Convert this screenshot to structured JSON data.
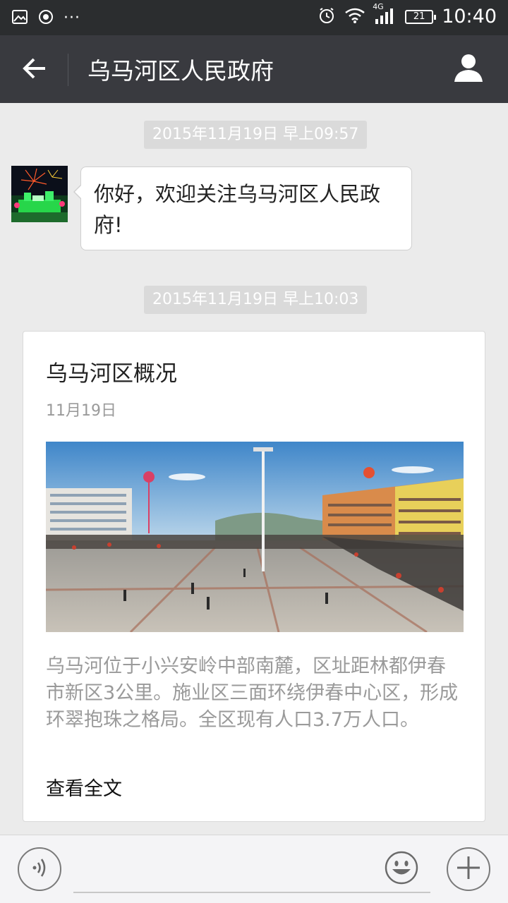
{
  "status_bar": {
    "time": "10:40",
    "battery_level": "21",
    "network": "4G",
    "left_icons": [
      "image-icon",
      "record-icon",
      "more-dots-icon"
    ],
    "right_icons": [
      "alarm-icon",
      "wifi-icon",
      "signal-icon",
      "battery-icon"
    ]
  },
  "header": {
    "title": "乌马河区人民政府",
    "back_icon": "arrow-left-icon",
    "profile_icon": "person-icon"
  },
  "messages": [
    {
      "timestamp": "2015年11月19日 早上09:57",
      "text": "你好，欢迎关注乌马河区人民政府!"
    },
    {
      "timestamp": "2015年11月19日 早上10:03",
      "article": {
        "title": "乌马河区概况",
        "date": "11月19日",
        "description": "乌马河位于小兴安岭中部南麓，区址距林都伊春市新区3公里。施业区三面环绕伊春中心区，形成环翠抱珠之格局。全区现有人口3.7万人口。",
        "read_more": "查看全文"
      }
    }
  ],
  "input_bar": {
    "voice_icon": "voice-icon",
    "emoji_icon": "emoji-icon",
    "plus_icon": "plus-icon",
    "input_value": ""
  },
  "colors": {
    "status_bar_bg": "#2b2d2f",
    "title_bar_bg": "#393a3f",
    "chat_bg": "#ebebeb",
    "timestamp_bg": "#dadada"
  }
}
